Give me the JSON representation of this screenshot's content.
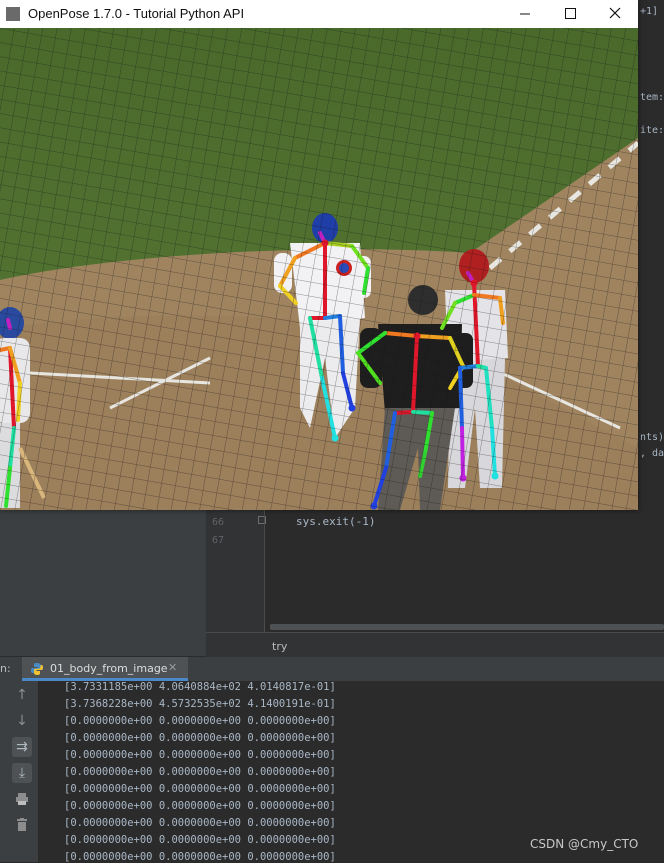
{
  "openpose_window": {
    "title": "OpenPose 1.7.0 - Tutorial Python API",
    "controls": {
      "minimize": "minimize-icon",
      "maximize": "maximize-icon",
      "close": "close-icon"
    }
  },
  "editor": {
    "line_numbers": [
      "66",
      "67"
    ],
    "code_line": "sys.exit(-1)",
    "right_snippets": [
      "+1]",
      "tem:",
      "ite:",
      "nts)",
      ", da"
    ],
    "breadcrumb": "try"
  },
  "run_panel": {
    "prefix": "n:",
    "tab_label": "01_body_from_image",
    "tab_icon": "python-icon",
    "close_icon": "close-icon",
    "toolbar_icons": [
      "arrow-up-icon",
      "arrow-down-icon",
      "soft-wrap-icon",
      "scroll-to-end-icon",
      "print-icon",
      "trash-icon"
    ],
    "output_lines": [
      "[3.7331185e+00 4.0640884e+02 4.0140817e-01]",
      "[3.7368228e+00 4.5732535e+02 4.1400191e-01]",
      "[0.0000000e+00 0.0000000e+00 0.0000000e+00]",
      "[0.0000000e+00 0.0000000e+00 0.0000000e+00]",
      "[0.0000000e+00 0.0000000e+00 0.0000000e+00]",
      "[0.0000000e+00 0.0000000e+00 0.0000000e+00]",
      "[0.0000000e+00 0.0000000e+00 0.0000000e+00]",
      "[0.0000000e+00 0.0000000e+00 0.0000000e+00]",
      "[0.0000000e+00 0.0000000e+00 0.0000000e+00]",
      "[0.0000000e+00 0.0000000e+00 0.0000000e+00]",
      "[0.0000000e+00 0.0000000e+00 0.0000000e+00]"
    ]
  },
  "watermark": "CSDN @Cmy_CTO",
  "colors": {
    "grass": "#4d6b2e",
    "dirt": "#a08460",
    "chalk": "#e8e6e0",
    "ide_bg": "#2b2b2b",
    "panel_bg": "#3c3f41",
    "console_text": "#a9b7c6",
    "tab_accent": "#4a88c7"
  }
}
